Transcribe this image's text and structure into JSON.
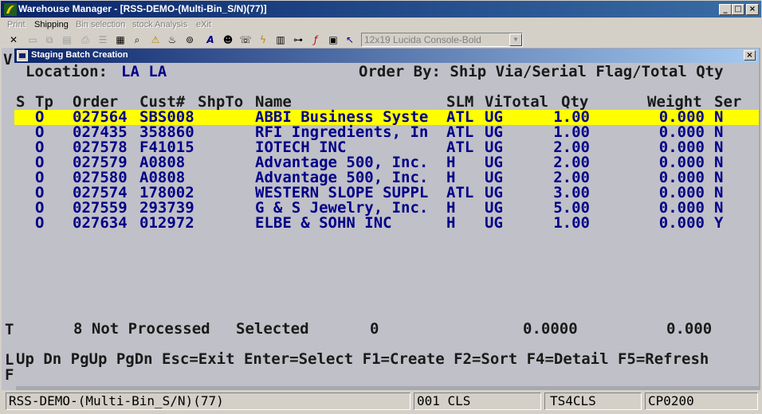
{
  "window": {
    "title": "Warehouse Manager - [RSS-DEMO-(Multi-Bin_S/N)(77)]",
    "btn_min": "_",
    "btn_max": "□",
    "btn_close": "×"
  },
  "menu": [
    {
      "label": "Print",
      "enabled": false
    },
    {
      "label": "Shipping",
      "enabled": true
    },
    {
      "label": "Bin selection",
      "enabled": false
    },
    {
      "label": "stock Analysis",
      "enabled": false
    },
    {
      "label": "eXit",
      "enabled": false
    }
  ],
  "toolbar": {
    "font_selector": "12x19 Lucida Console-Bold",
    "icons": [
      "close-x-icon",
      "blank-page-icon",
      "copy-icon",
      "paste-icon",
      "print-icon",
      "list-icon",
      "find-icon",
      "warning-icon",
      "bell-icon",
      "binoculars-icon",
      "font-icon",
      "person-icon",
      "lightning-icon",
      "chart-icon",
      "chain-icon",
      "function-icon",
      "book-icon",
      "help-pointer-icon"
    ]
  },
  "child_window": {
    "title": "Staging Batch Creation",
    "close": "×"
  },
  "screen": {
    "location_label": "Location:",
    "location_value": "LA LA",
    "order_by": "Order By: Ship Via/Serial Flag/Total Qty",
    "headers": {
      "s": "S",
      "tp": "Tp",
      "order": "Order",
      "cust": "Cust#",
      "shipto": "ShpTo",
      "name": "Name",
      "slm": "SLM",
      "via_total": "ViTotal",
      "qty": "Qty",
      "weight": "Weight",
      "ser": "Ser"
    },
    "rows": [
      {
        "tp": "O",
        "order": "027564",
        "cust": "SBS008",
        "name": "ABBI Business Syste",
        "slm": "ATL",
        "via": "UG",
        "qty": "1.00",
        "weight": "0.000",
        "ser": "N",
        "selected": true
      },
      {
        "tp": "O",
        "order": "027435",
        "cust": "358860",
        "name": "RFI Ingredients, In",
        "slm": "ATL",
        "via": "UG",
        "qty": "1.00",
        "weight": "0.000",
        "ser": "N",
        "selected": false
      },
      {
        "tp": "O",
        "order": "027578",
        "cust": "F41015",
        "name": "IOTECH INC",
        "slm": "ATL",
        "via": "UG",
        "qty": "2.00",
        "weight": "0.000",
        "ser": "N",
        "selected": false
      },
      {
        "tp": "O",
        "order": "027579",
        "cust": "A0808",
        "name": "Advantage 500, Inc.",
        "slm": "H",
        "via": "UG",
        "qty": "2.00",
        "weight": "0.000",
        "ser": "N",
        "selected": false
      },
      {
        "tp": "O",
        "order": "027580",
        "cust": "A0808",
        "name": "Advantage 500, Inc.",
        "slm": "H",
        "via": "UG",
        "qty": "2.00",
        "weight": "0.000",
        "ser": "N",
        "selected": false
      },
      {
        "tp": "O",
        "order": "027574",
        "cust": "178002",
        "name": "WESTERN SLOPE SUPPL",
        "slm": "ATL",
        "via": "UG",
        "qty": "3.00",
        "weight": "0.000",
        "ser": "N",
        "selected": false
      },
      {
        "tp": "O",
        "order": "027559",
        "cust": "293739",
        "name": "G & S Jewelry, Inc.",
        "slm": "H",
        "via": "UG",
        "qty": "5.00",
        "weight": "0.000",
        "ser": "N",
        "selected": false
      },
      {
        "tp": "O",
        "order": "027634",
        "cust": "012972",
        "name": "ELBE & SOHN INC",
        "slm": "H",
        "via": "UG",
        "qty": "1.00",
        "weight": "0.000",
        "ser": "Y",
        "selected": false
      }
    ],
    "summary": {
      "not_processed": "8 Not Processed",
      "selected_label": "Selected",
      "selected_count": "0",
      "total_qty": "0.0000",
      "total_weight": "0.000"
    },
    "keys": "Up Dn PgUp PgDn Esc=Exit Enter=Select F1=Create F2=Sort F4=Detail F5=Refresh"
  },
  "behind": {
    "v": "V",
    "t": "T",
    "l": "L",
    "f": "F"
  },
  "statusbar": {
    "company": "RSS-DEMO-(Multi-Bin_S/N)(77)",
    "branch": "001 CLS",
    "terminal": "TS4CLS",
    "printer": "CP0200"
  }
}
